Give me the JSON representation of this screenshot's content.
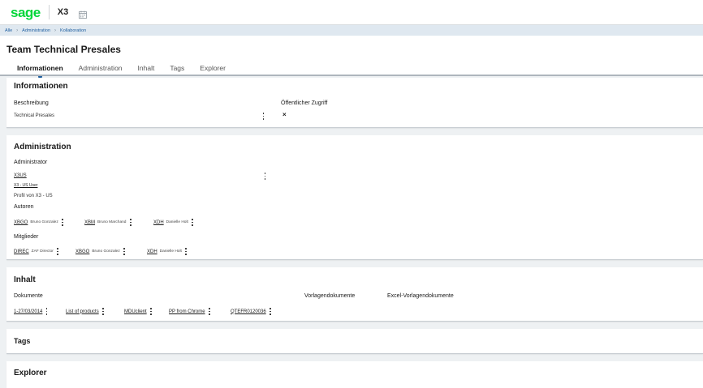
{
  "topbar": {
    "logo": "sage",
    "app_code": "X3",
    "calendar_icon": "calendar-icon"
  },
  "breadcrumb": {
    "items": [
      "Alle",
      "Administration",
      "Kollaboration"
    ]
  },
  "page": {
    "title": "Team Technical Presales"
  },
  "tabs": [
    {
      "label": "Informationen",
      "active": true
    },
    {
      "label": "Administration",
      "active": false
    },
    {
      "label": "Inhalt",
      "active": false
    },
    {
      "label": "Tags",
      "active": false
    },
    {
      "label": "Explorer",
      "active": false
    }
  ],
  "info": {
    "title": "Informationen",
    "description_label": "Beschreibung",
    "description_value": "Technical Presales",
    "public_access_label": "Öffentlicher Zugriff",
    "public_access_value": "×"
  },
  "admin": {
    "title": "Administration",
    "administrator_label": "Administrator",
    "admin_code": "X3US",
    "admin_user": "X3 - US User",
    "admin_profile": "Profil von X3 - US",
    "authors_label": "Autoren",
    "authors": [
      {
        "code": "XBGO",
        "name": "Bruno Gonzalez"
      },
      {
        "code": "XBM",
        "name": "Bruno Marchand"
      },
      {
        "code": "XDH",
        "name": "Danielle Holt"
      }
    ],
    "members_label": "Mitglieder",
    "members": [
      {
        "code": "DIREC",
        "name": "ZAF Director"
      },
      {
        "code": "XBGO",
        "name": "Bruno Gonzalez"
      },
      {
        "code": "XDH",
        "name": "Danielle Holt"
      }
    ]
  },
  "content": {
    "title": "Inhalt",
    "documents_label": "Dokumente",
    "template_docs_label": "Vorlagendokumente",
    "excel_template_docs_label": "Excel-Vorlagendokumente",
    "documents": [
      "1-27/03/2014",
      "List of products",
      "MDUclient",
      "PP from Chrome",
      "QTEFR0120036"
    ]
  },
  "tags": {
    "title": "Tags"
  },
  "explorer": {
    "title": "Explorer"
  },
  "colors": {
    "brand": "#00d639",
    "link": "#1f5fa0",
    "background": "#eef1f3"
  }
}
